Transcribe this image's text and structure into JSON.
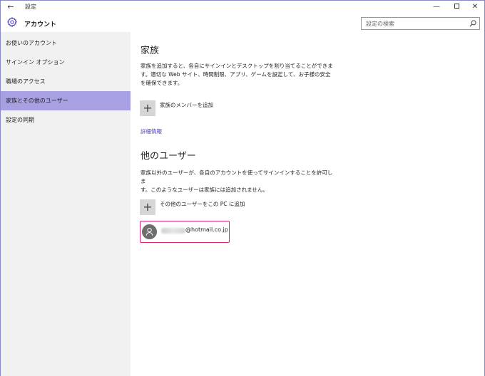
{
  "titlebar": {
    "back_glyph": "←",
    "title": "設定",
    "minimize_glyph": "—",
    "close_glyph": "✕"
  },
  "header": {
    "icon": "gear-icon",
    "title": "アカウント",
    "search_placeholder": "設定の検索"
  },
  "sidebar": {
    "items": [
      {
        "label": "お使いのアカウント",
        "active": false
      },
      {
        "label": "サインイン オプション",
        "active": false
      },
      {
        "label": "職場のアクセス",
        "active": false
      },
      {
        "label": "家族とその他のユーザー",
        "active": true
      },
      {
        "label": "設定の同期",
        "active": false
      }
    ]
  },
  "main": {
    "family": {
      "heading": "家族",
      "description_line1": "家族を追加すると、各自にサインインとデスクトップを割り当てることができま",
      "description_line2": "す。適切な Web サイト、時間制限、アプリ、ゲームを設定して、お子様の安全",
      "description_line3": "を確保できます。",
      "add_label": "家族のメンバーを追加",
      "link_label": "詳細情報"
    },
    "others": {
      "heading": "他のユーザー",
      "description_line1": "家族以外のユーザーが、各自のアカウントを使ってサインインすることを許可しま",
      "description_line2": "す。このようなユーザーは家族には追加されません。",
      "add_label": "その他のユーザーをこの PC に追加",
      "plus_glyph": "+",
      "account": {
        "icon": "user-icon",
        "email_domain": "@hotmail.co.jp"
      }
    }
  },
  "colors": {
    "accent_active": "#a7a1e3",
    "link": "#4a3fbf",
    "highlight_border": "#e0247a"
  }
}
